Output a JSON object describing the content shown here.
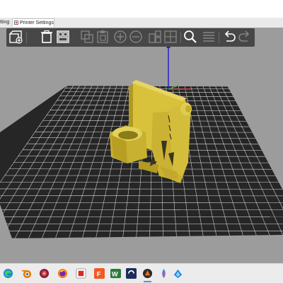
{
  "tabs": [
    {
      "label": "ttings",
      "selected": false
    },
    {
      "label": "Printer Settings",
      "selected": true
    }
  ],
  "toolbar": {
    "items": [
      {
        "name": "add-icon",
        "enabled": true
      },
      {
        "name": "delete-icon",
        "enabled": true
      },
      {
        "name": "arrange-icon",
        "enabled": true
      },
      {
        "name": "copy-icon",
        "enabled": false
      },
      {
        "name": "paste-icon",
        "enabled": false
      },
      {
        "name": "add-instance-icon",
        "enabled": false
      },
      {
        "name": "remove-instance-icon",
        "enabled": false
      },
      {
        "name": "split-objects-icon",
        "enabled": false
      },
      {
        "name": "split-parts-icon",
        "enabled": false
      },
      {
        "name": "search-icon",
        "enabled": true
      },
      {
        "name": "layers-editing-icon",
        "enabled": false
      },
      {
        "name": "undo-icon",
        "enabled": true
      },
      {
        "name": "redo-icon",
        "enabled": false
      }
    ]
  },
  "scene": {
    "bed_color": "#262626",
    "grid_color": "#dcdcdc",
    "model_color": "#d8c23c",
    "axis_colors": {
      "x": "#d23030",
      "y": "#2db33a",
      "z": "#2323c8"
    }
  },
  "taskbar": {
    "apps": [
      {
        "name": "edge-icon",
        "label": ""
      },
      {
        "name": "blender-icon",
        "label": ""
      },
      {
        "name": "photos-icon",
        "label": ""
      },
      {
        "name": "firefox-icon",
        "label": ""
      },
      {
        "name": "flashprint-icon",
        "label": ""
      },
      {
        "name": "fusion-icon",
        "label": "F"
      },
      {
        "name": "word-icon",
        "label": "W"
      },
      {
        "name": "cura-icon",
        "label": ""
      },
      {
        "name": "prusaslicer-icon",
        "label": ""
      },
      {
        "name": "krita-icon",
        "label": ""
      },
      {
        "name": "dropbox-icon",
        "label": ""
      }
    ]
  }
}
